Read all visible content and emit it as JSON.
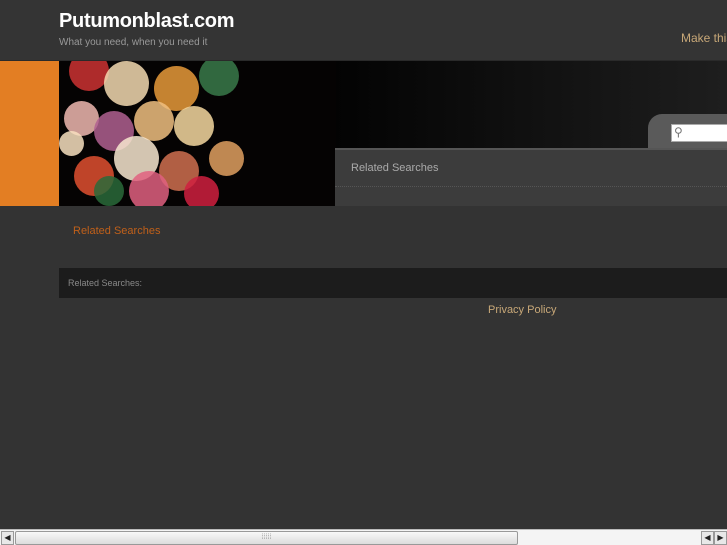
{
  "header": {
    "title": "Putumonblast.com",
    "tagline": "What you need, when you need it",
    "make_home": "Make this"
  },
  "search": {
    "placeholder": ""
  },
  "banner": {
    "related_title": "Related Searches"
  },
  "content": {
    "related_link": "Related Searches",
    "related_bar_label": "Related Searches:",
    "privacy": "Privacy Policy"
  },
  "scrollbar": {
    "left": "◀",
    "right": "▶",
    "left2": "◀",
    "grip": "⁞⁞⁞⁞⁞"
  }
}
